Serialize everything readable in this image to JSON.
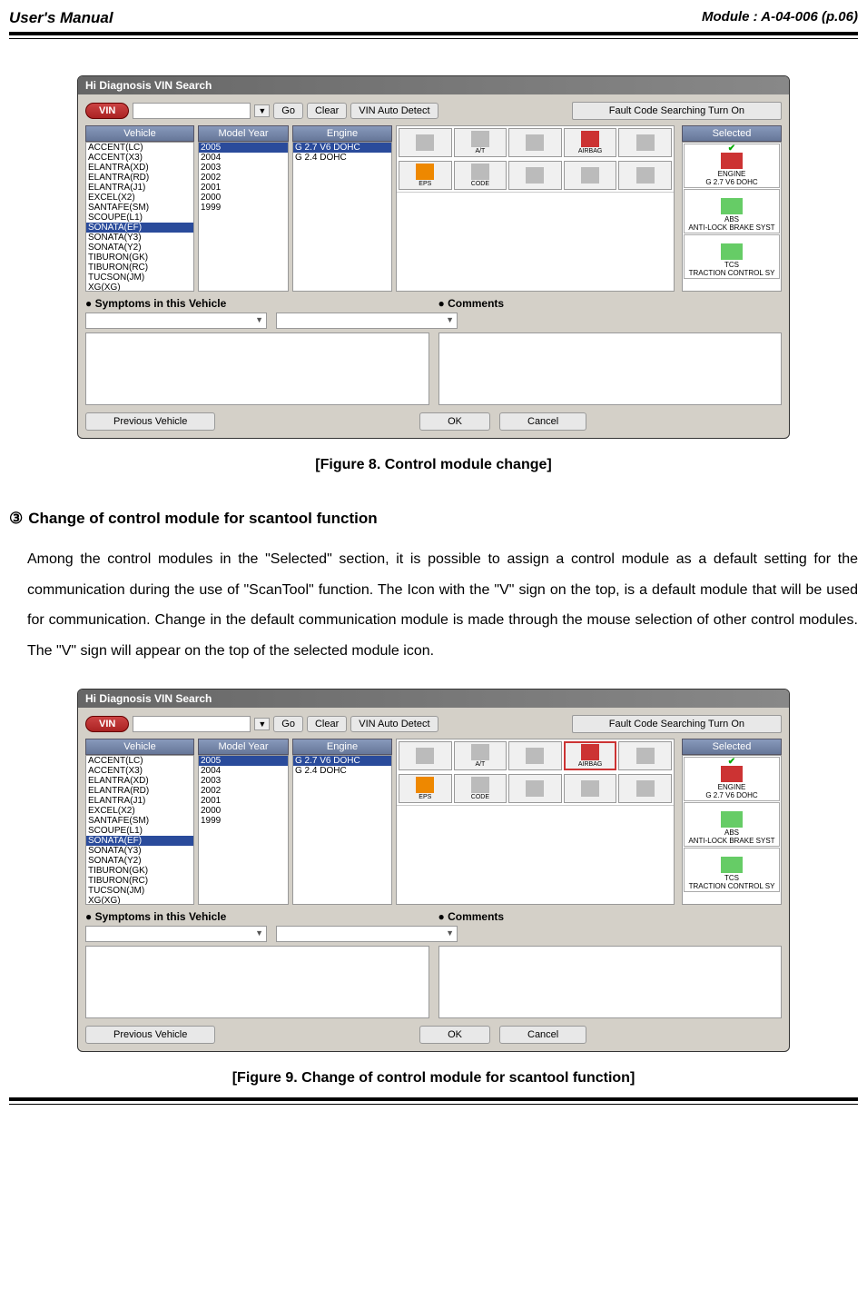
{
  "header": {
    "left": "User's Manual",
    "right": "Module : A-04-006 (p.06)"
  },
  "dialog": {
    "title": "Hi Diagnosis VIN Search",
    "vin_label": "VIN",
    "go_label": "Go",
    "clear_label": "Clear",
    "autodetect_label": "VIN Auto Detect",
    "fault_label": "Fault Code Searching Turn On",
    "columns": {
      "vehicle": "Vehicle",
      "model_year": "Model Year",
      "engine": "Engine",
      "selected": "Selected"
    },
    "vehicles": [
      "ACCENT(LC)",
      "ACCENT(X3)",
      "ELANTRA(XD)",
      "ELANTRA(RD)",
      "ELANTRA(J1)",
      "EXCEL(X2)",
      "SANTAFE(SM)",
      "SCOUPE(L1)",
      "SONATA(EF)",
      "SONATA(Y3)",
      "SONATA(Y2)",
      "TIBURON(GK)",
      "TIBURON(RC)",
      "TUCSON(JM)",
      "XG(XG)"
    ],
    "vehicle_selected_index": 8,
    "years": [
      "2005",
      "2004",
      "2003",
      "2002",
      "2001",
      "2000",
      "1999"
    ],
    "year_selected_index": 0,
    "engines": [
      "G 2.7 V6 DOHC",
      "G 2.4 DOHC"
    ],
    "engine_selected_index": 0,
    "system_row1": [
      "",
      "A/T",
      "",
      "AIRBAG",
      ""
    ],
    "system_row2": [
      "EPS",
      "CODE",
      "",
      "",
      ""
    ],
    "selected_items": [
      {
        "icon": "engine",
        "label": "ENGINE",
        "sub": "G 2.7 V6 DOHC",
        "check": true
      },
      {
        "icon": "abs",
        "label": "ABS",
        "sub": "ANTI-LOCK BRAKE SYST",
        "check": false
      },
      {
        "icon": "tcs",
        "label": "TCS",
        "sub": "TRACTION CONTROL SY",
        "check": false
      }
    ],
    "symptoms_label": "Symptoms in this Vehicle",
    "comments_label": "Comments",
    "prev_label": "Previous Vehicle",
    "ok_label": "OK",
    "cancel_label": "Cancel"
  },
  "fig8_caption": "[Figure 8. Control module change]",
  "section": {
    "number": "③",
    "title": "Change of control module for scantool function",
    "body": "Among the control modules in the \"Selected\" section, it is possible to assign a control module as a default setting for the communication during the use of \"ScanTool\" function. The Icon with the \"V\" sign on the top, is a default module that will be used for communication. Change in the default communication module is made through the mouse selection of other control modules. The \"V\" sign will appear on the top of the selected module icon."
  },
  "fig9_caption": "[Figure 9. Change of control module for scantool function]",
  "dialog2_airbag_selected": true
}
